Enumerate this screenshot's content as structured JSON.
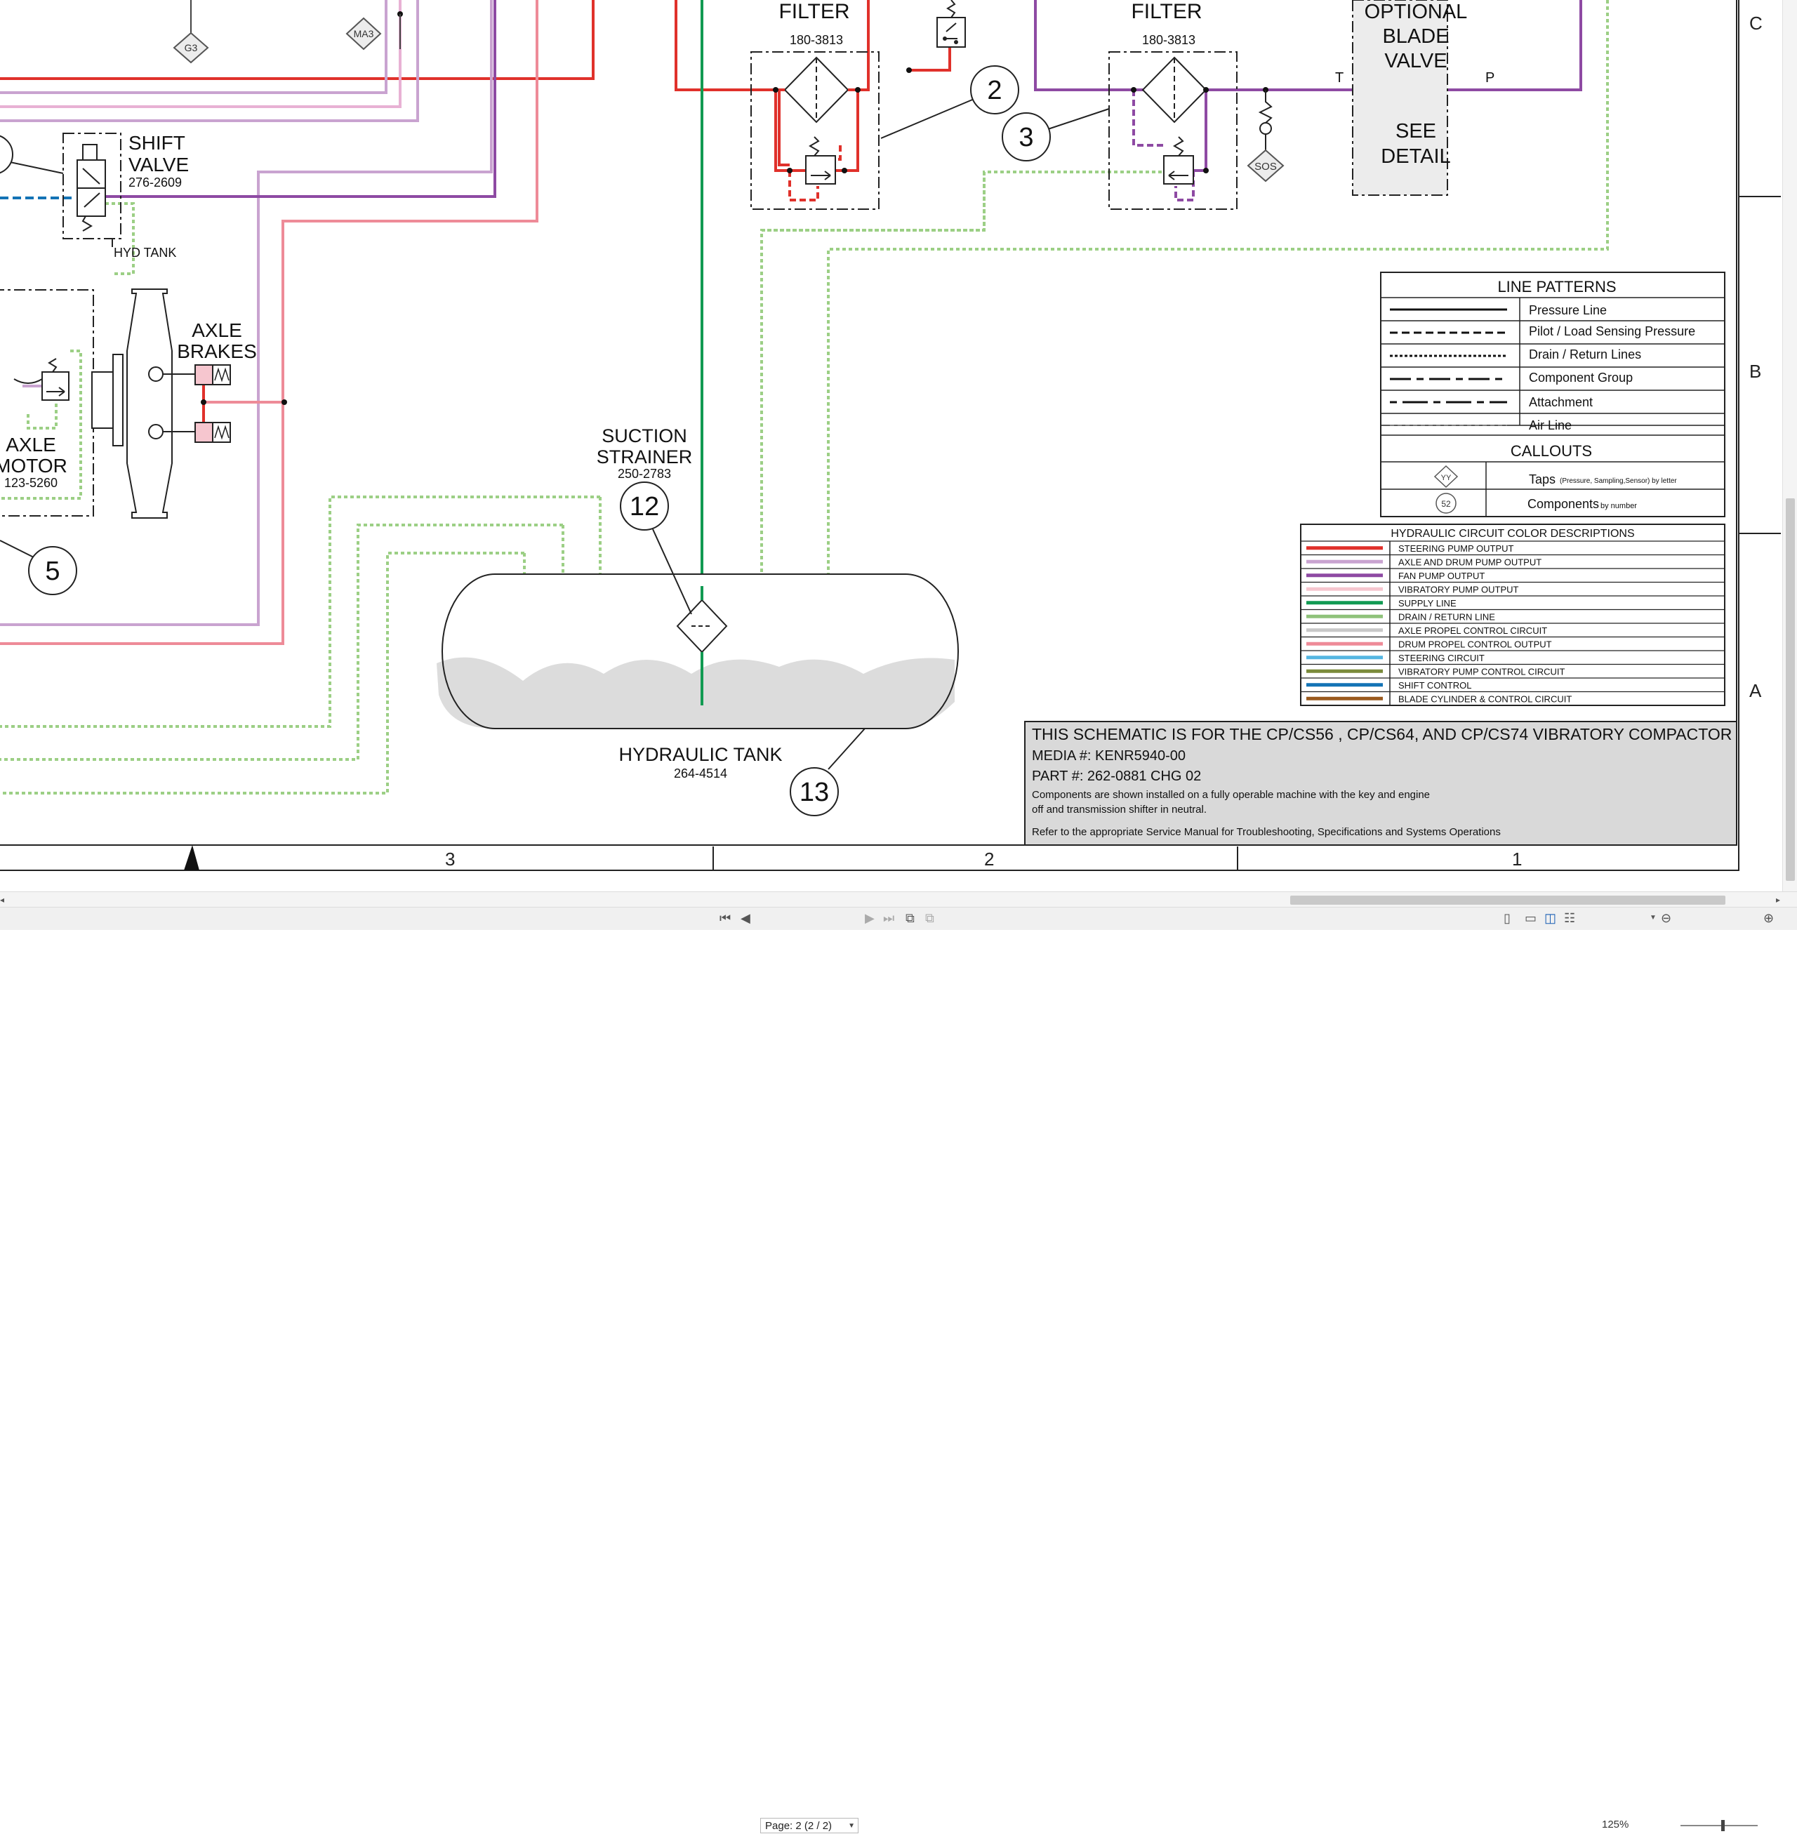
{
  "document": {
    "tap_labels": {
      "g3": "G3",
      "ma3": "MA3",
      "sos": "SOS"
    },
    "filter_left": {
      "title": "FILTER",
      "part": "180-3813",
      "callout": "2"
    },
    "filter_right": {
      "title": "FILTER",
      "part": "180-3813",
      "callout": "3"
    },
    "optional_valve": {
      "line1": "OPTIONAL",
      "line2": "BLADE",
      "line3": "VALVE",
      "detail1": "SEE",
      "detail2": "DETAIL",
      "port_t": "T",
      "port_p": "P"
    },
    "shift_valve": {
      "line1": "SHIFT",
      "line2": "VALVE",
      "part": "276-2609",
      "tank": "HYD TANK"
    },
    "axle_brakes": {
      "line1": "AXLE",
      "line2": "BRAKES"
    },
    "axle_motor": {
      "line1": "AXLE",
      "line2": "MOTOR",
      "part": "123-5260",
      "callout": "5"
    },
    "suction_strainer": {
      "line1": "SUCTION",
      "line2": "STRAINER",
      "part": "250-2783",
      "callout": "12"
    },
    "hydraulic_tank": {
      "title": "HYDRAULIC TANK",
      "part": "264-4514",
      "callout": "13"
    },
    "zones": {
      "c": "C",
      "b": "B",
      "a": "A",
      "col3": "3",
      "col2": "2",
      "col1": "1"
    },
    "line_patterns": {
      "title": "LINE PATTERNS",
      "rows": [
        "Pressure Line",
        "Pilot / Load Sensing Pressure",
        "Drain / Return Lines",
        "Component Group",
        "Attachment",
        "Air Line"
      ],
      "callouts_title": "CALLOUTS",
      "taps_main": "Taps",
      "taps_sub": "(Pressure, Sampling,Sensor) by letter",
      "taps_symbol": "YY",
      "components_main": "Components",
      "components_sub": "by number",
      "components_symbol": "52"
    },
    "color_legend": {
      "title": "HYDRAULIC CIRCUIT COLOR DESCRIPTIONS",
      "rows": [
        {
          "label": "STEERING PUMP OUTPUT",
          "color": "#e0312b"
        },
        {
          "label": "AXLE AND DRUM PUMP OUTPUT",
          "color": "#c9a3d0"
        },
        {
          "label": "FAN PUMP OUTPUT",
          "color": "#8e4aa3"
        },
        {
          "label": "VIBRATORY PUMP OUTPUT",
          "color": "#f6c6cf"
        },
        {
          "label": "SUPPLY LINE",
          "color": "#119a52"
        },
        {
          "label": "DRAIN / RETURN LINE",
          "color": "#8fc27a"
        },
        {
          "label": "AXLE PROPEL CONTROL CIRCUIT",
          "color": "#c8c8c8"
        },
        {
          "label": "DRUM PROPEL CONTROL OUTPUT",
          "color": "#ee8b98"
        },
        {
          "label": "STEERING CIRCUIT",
          "color": "#55b6e1"
        },
        {
          "label": "VIBRATORY PUMP CONTROL CIRCUIT",
          "color": "#7a8a3a"
        },
        {
          "label": "SHIFT CONTROL",
          "color": "#1373b5"
        },
        {
          "label": "BLADE CYLINDER & CONTROL CIRCUIT",
          "color": "#9a5a1e"
        }
      ]
    },
    "title_block": {
      "heading": "THIS SCHEMATIC IS FOR THE CP/CS56 , CP/CS64, AND CP/CS74 VIBRATORY COMPACTOR",
      "media": "MEDIA #: KENR5940-00",
      "part": "PART #: 262-0881 CHG 02",
      "note1": "Components are shown installed on a fully operable machine with the key and engine",
      "note2": "off and transmission shifter in neutral.",
      "note3": "Refer to the appropriate Service Manual for Troubleshooting, Specifications and Systems Operations"
    }
  },
  "toolbar": {
    "page_value": "Page: 2 (2 / 2)",
    "zoom": "125%",
    "icons": [
      "first-page-icon",
      "prev-page-icon",
      "next-page-icon",
      "last-page-icon",
      "back-view-icon",
      "forward-view-icon",
      "single-page-icon",
      "continuous-icon",
      "two-page-icon",
      "two-page-continuous-icon",
      "zoom-out-icon",
      "zoom-in-icon"
    ]
  },
  "colors": {
    "pressure_red": "#e0312b",
    "light_purple": "#c9a3d0",
    "fan_purple": "#8e4aa3",
    "supply_green": "#119a52",
    "drain_green": "#9ccf85",
    "drum_pink": "#ee8b98",
    "shift_blue": "#1373b5",
    "title_block_bg": "#d9d9d9"
  }
}
